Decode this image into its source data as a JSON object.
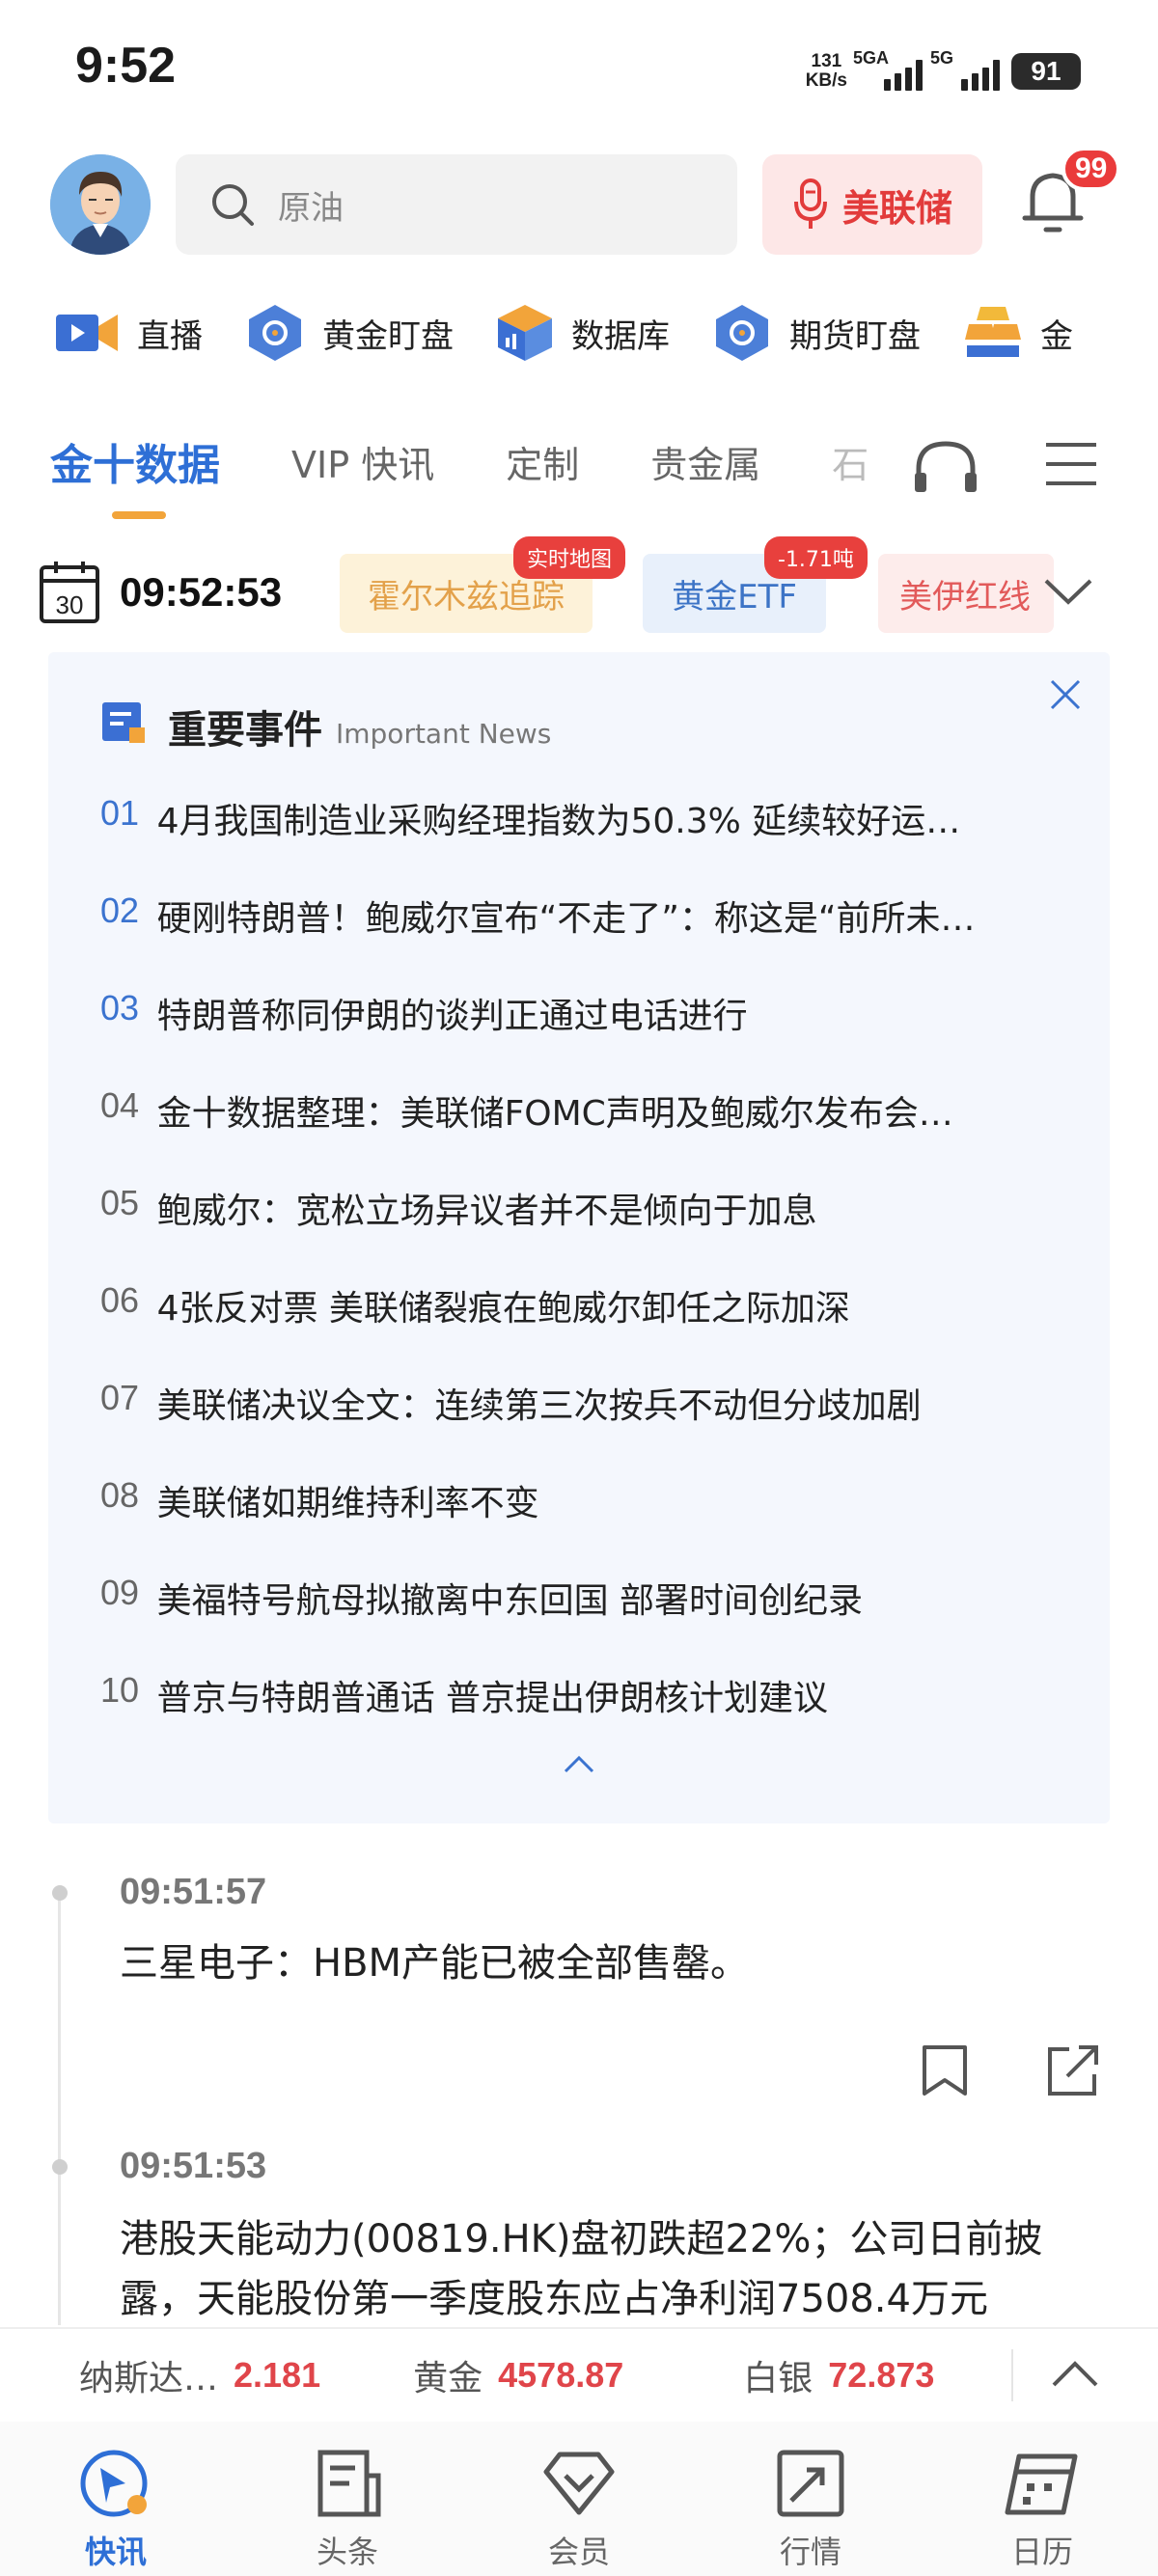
{
  "status_bar": {
    "time": "9:52",
    "net_speed_value": "131",
    "net_speed_unit": "KB/s",
    "signal1_label": "5GA",
    "signal2_label": "5G",
    "battery": "91"
  },
  "header": {
    "search_placeholder": "原油",
    "fed_button_label": "美联储",
    "notification_count": "99"
  },
  "quick_nav": [
    {
      "label": "直播",
      "icon": "video-icon"
    },
    {
      "label": "黄金盯盘",
      "icon": "target-icon"
    },
    {
      "label": "数据库",
      "icon": "database-icon"
    },
    {
      "label": "期货盯盘",
      "icon": "target-icon"
    },
    {
      "label": "金",
      "icon": "gold-bars-icon"
    }
  ],
  "tabs": [
    {
      "label": "金十数据",
      "active": true
    },
    {
      "label": "VIP 快讯"
    },
    {
      "label": "定制"
    },
    {
      "label": "贵金属"
    },
    {
      "label": "石"
    }
  ],
  "time_bar": {
    "calendar_day": "30",
    "clock": "09:52:53",
    "chips": [
      {
        "label": "霍尔木兹追踪",
        "tag": "实时地图"
      },
      {
        "label": "黄金ETF",
        "tag": "-1.71吨"
      },
      {
        "label": "美伊红线"
      }
    ]
  },
  "important_news": {
    "title": "重要事件",
    "subtitle": "Important News",
    "items": [
      {
        "num": "01",
        "text": "4月我国制造业采购经理指数为50.3% 延续较好运…"
      },
      {
        "num": "02",
        "text": "硬刚特朗普！鲍威尔宣布“不走了”：称这是“前所未…"
      },
      {
        "num": "03",
        "text": "特朗普称同伊朗的谈判正通过电话进行"
      },
      {
        "num": "04",
        "text": "金十数据整理：美联储FOMC声明及鲍威尔发布会…"
      },
      {
        "num": "05",
        "text": "鲍威尔：宽松立场异议者并不是倾向于加息"
      },
      {
        "num": "06",
        "text": "4张反对票 美联储裂痕在鲍威尔卸任之际加深"
      },
      {
        "num": "07",
        "text": "美联储决议全文：连续第三次按兵不动但分歧加剧"
      },
      {
        "num": "08",
        "text": "美联储如期维持利率不变"
      },
      {
        "num": "09",
        "text": "美福特号航母拟撤离中东回国 部署时间创纪录"
      },
      {
        "num": "10",
        "text": "普京与特朗普通话 普京提出伊朗核计划建议"
      }
    ]
  },
  "feed": [
    {
      "time": "09:51:57",
      "text": "三星电子：HBM产能已被全部售罄。"
    },
    {
      "time": "09:51:53",
      "text": "港股天能动力(00819.HK)盘初跌超22%；公司日前披",
      "text2": "露，天能股份第一季度股东应占净利润7508.4万元"
    }
  ],
  "ticker": [
    {
      "name": "纳斯达…",
      "value": "2.181"
    },
    {
      "name": "黄金",
      "value": "4578.87"
    },
    {
      "name": "白银",
      "value": "72.873"
    }
  ],
  "bottom_nav": [
    {
      "label": "快讯",
      "active": true
    },
    {
      "label": "头条"
    },
    {
      "label": "会员"
    },
    {
      "label": "行情"
    },
    {
      "label": "日历"
    }
  ],
  "colors": {
    "accent": "#2e6fd6",
    "red": "#e0454a",
    "news_bg": "#f4f7fd"
  }
}
